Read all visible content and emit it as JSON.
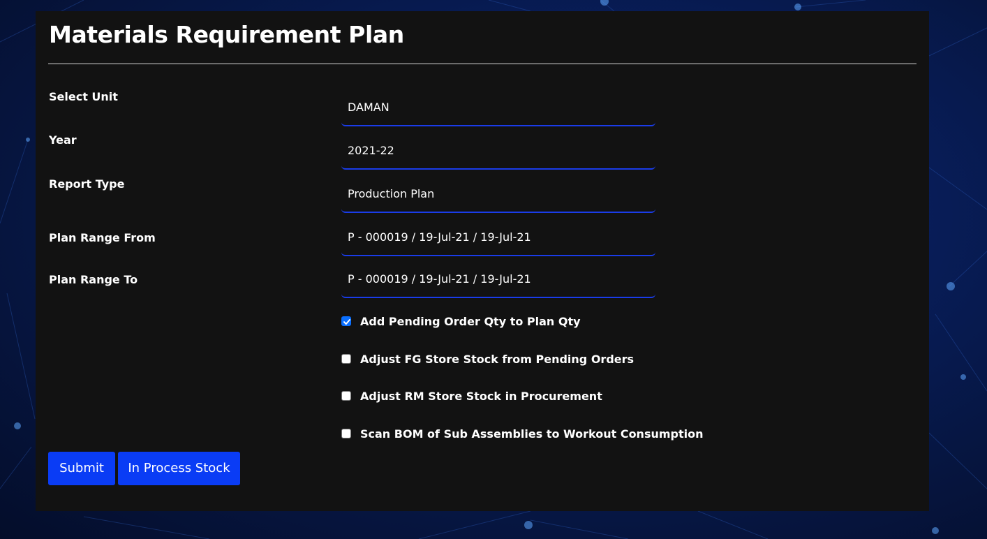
{
  "page": {
    "title": "Materials Requirement Plan"
  },
  "form": {
    "fields": [
      {
        "label": "Select Unit",
        "value": "DAMAN"
      },
      {
        "label": "Year",
        "value": "2021-22"
      },
      {
        "label": "Report Type",
        "value": "Production Plan"
      },
      {
        "label": "Plan Range From",
        "value": "P - 000019 / 19-Jul-21 / 19-Jul-21"
      },
      {
        "label": "Plan Range To",
        "value": "P - 000019 / 19-Jul-21 / 19-Jul-21"
      }
    ],
    "options": [
      {
        "label": "Add Pending Order Qty to Plan Qty",
        "checked": true
      },
      {
        "label": "Adjust FG Store Stock from Pending Orders",
        "checked": false
      },
      {
        "label": "Adjust RM Store Stock in Procurement",
        "checked": false
      },
      {
        "label": "Scan BOM of Sub Assemblies to Workout Consumption",
        "checked": false
      }
    ]
  },
  "buttons": {
    "submit_label": "Submit",
    "in_process_label": "In Process Stock"
  },
  "colors": {
    "accent": "#0a3cf5",
    "field_underline": "#1a3ce8",
    "card_background": "#121212",
    "checkbox_checked": "#0a6fff"
  }
}
